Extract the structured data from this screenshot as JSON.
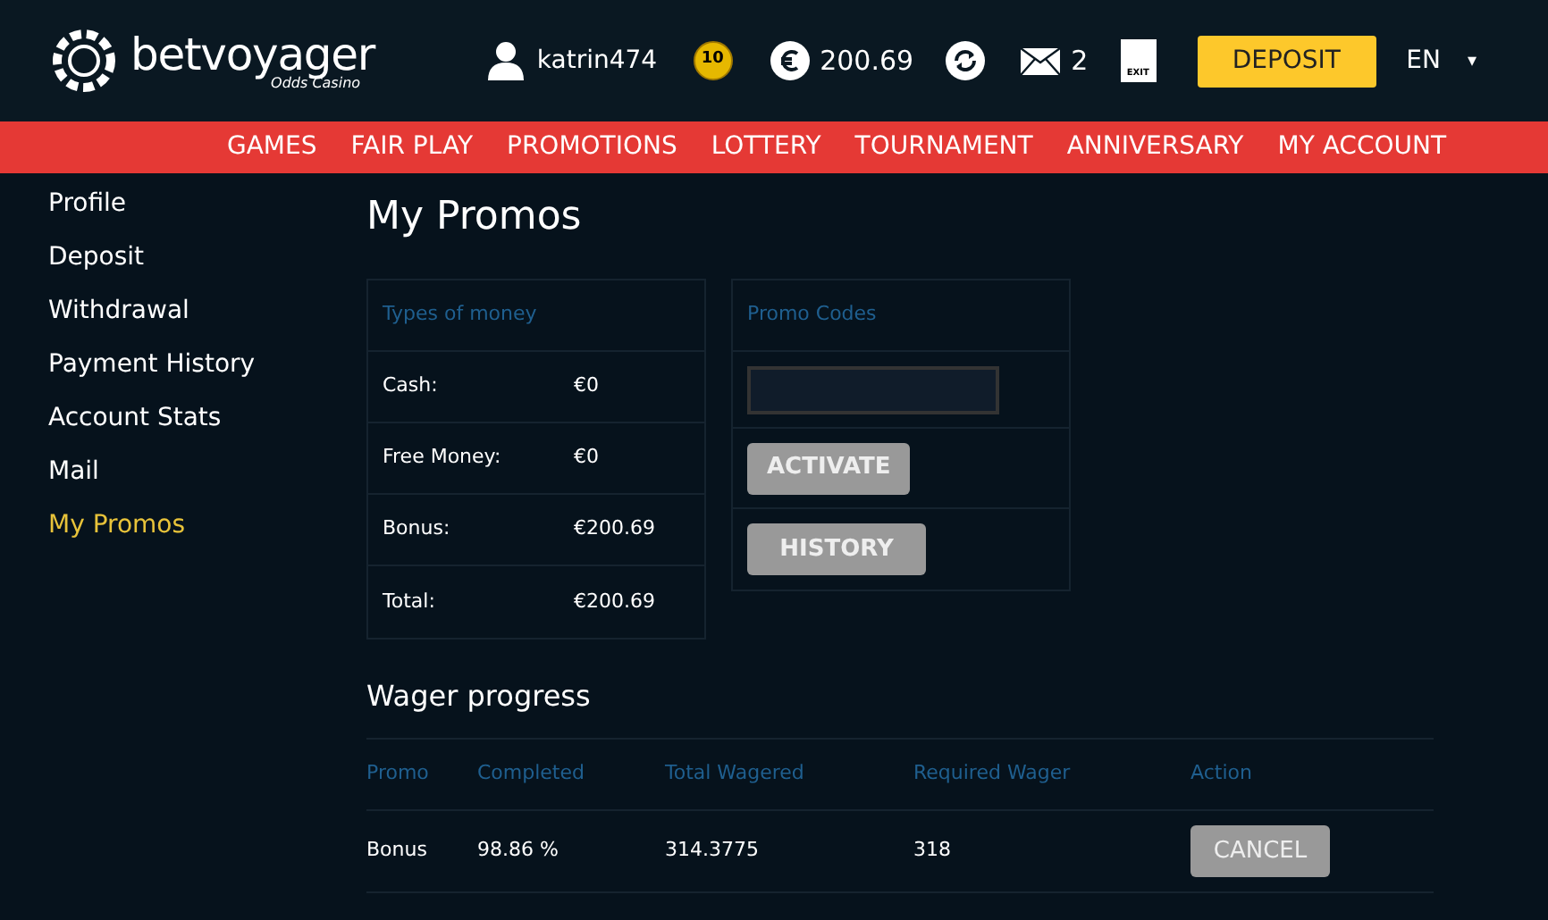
{
  "header": {
    "logo": {
      "name": "betvoyager",
      "tagline": "Odds Casino"
    },
    "username": "katrin474",
    "coin_badge": "10",
    "balance": "200.69",
    "messages_count": "2",
    "exit_label": "EXIT",
    "deposit_button": "DEPOSIT",
    "language": "EN",
    "language_caret": "▾"
  },
  "nav": [
    {
      "label": "GAMES",
      "selected": false
    },
    {
      "label": "FAIR PLAY",
      "selected": false
    },
    {
      "label": "PROMOTIONS",
      "selected": false
    },
    {
      "label": "LOTTERY",
      "selected": false
    },
    {
      "label": "TOURNAMENT",
      "selected": false
    },
    {
      "label": "ANNIVERSARY",
      "selected": false
    },
    {
      "label": "MY ACCOUNT",
      "selected": false
    }
  ],
  "sidebar": {
    "items": [
      {
        "label": "Profile",
        "selected": false
      },
      {
        "label": "Deposit",
        "selected": false
      },
      {
        "label": "Withdrawal",
        "selected": false
      },
      {
        "label": "Payment History",
        "selected": false
      },
      {
        "label": "Account Stats",
        "selected": false
      },
      {
        "label": "Mail",
        "selected": false
      },
      {
        "label": "My Promos",
        "selected": true
      }
    ]
  },
  "page_title": "My Promos",
  "money_table": {
    "heading": "Types of money",
    "rows": [
      {
        "label": "Cash:",
        "value": "€0"
      },
      {
        "label": "Free Money:",
        "value": "€0"
      },
      {
        "label": "Bonus:",
        "value": "€200.69"
      },
      {
        "label": "Total:",
        "value": "€200.69"
      }
    ]
  },
  "promo_codes": {
    "heading": "Promo Codes",
    "buttons": [
      "ACTIVATE",
      "HISTORY"
    ]
  },
  "wager": {
    "title": "Wager progress",
    "columns": [
      "Promo",
      "Completed",
      "Total Wagered",
      "Required Wager",
      "Action"
    ],
    "rows": [
      {
        "cells": [
          "Bonus",
          "98.86 %",
          "314.3775",
          "318"
        ],
        "action": "CANCEL"
      }
    ]
  }
}
